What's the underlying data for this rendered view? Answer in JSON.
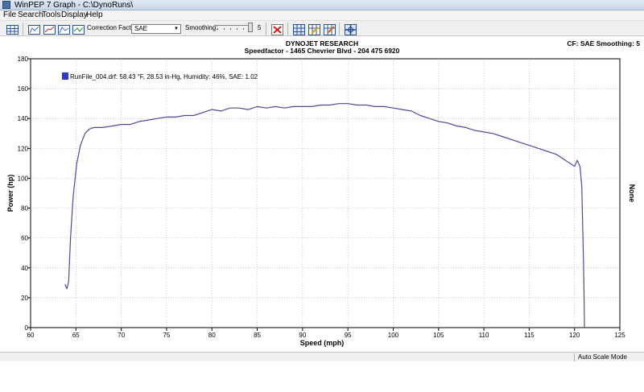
{
  "window": {
    "title": "WinPEP 7    Graph - C:\\DynoRuns\\"
  },
  "menu": {
    "items": [
      "File",
      "Search",
      "Tools",
      "Display",
      "Help"
    ]
  },
  "toolbar": {
    "correction_factor_label": "Correction Factor:",
    "correction_factor_value": "SAE",
    "smoothing_label": "Smoothing:",
    "smoothing_value": "5"
  },
  "header": {
    "company": "DYNOJET RESEARCH",
    "address": "Speedfactor - 1465 Chevrier Blvd - 204 475 6920",
    "cf_info": "CF: SAE  Smoothing: 5"
  },
  "right_axis_label": "None",
  "status": {
    "mode": "Auto Scale Mode"
  },
  "colors": {
    "plot_line": "#4b4b9a",
    "legend_swatch": "#2b3cc8",
    "grid": "#b4b4b4"
  },
  "chart_data": {
    "type": "line",
    "xlabel": "Speed (mph)",
    "ylabel": "Power (hp)",
    "xlim": [
      60,
      125
    ],
    "ylim": [
      0,
      180
    ],
    "x_ticks": [
      60,
      65,
      70,
      75,
      80,
      85,
      90,
      95,
      100,
      105,
      110,
      115,
      120,
      125
    ],
    "y_ticks": [
      0,
      20,
      40,
      60,
      80,
      100,
      120,
      140,
      160,
      180
    ],
    "grid": true,
    "legend_position": "top-left",
    "series": [
      {
        "name": "RunFile_004.drf: 58.43 °F, 28.53 in-Hg, Humidity: 46%, SAE: 1.02",
        "x": [
          63.8,
          64.0,
          64.2,
          64.4,
          64.7,
          65.1,
          65.5,
          66.0,
          66.5,
          67.0,
          68.0,
          69.0,
          70.0,
          71.0,
          72.0,
          73.0,
          74.0,
          75.0,
          76.0,
          77.0,
          78.0,
          79.0,
          80.0,
          81.0,
          82.0,
          83.0,
          84.0,
          85.0,
          86.0,
          87.0,
          88.0,
          89.0,
          90.0,
          91.0,
          92.0,
          93.0,
          94.0,
          95.0,
          96.0,
          97.0,
          98.0,
          99.0,
          100.0,
          101.0,
          102.0,
          103.0,
          104.0,
          105.0,
          106.0,
          107.0,
          108.0,
          109.0,
          110.0,
          111.0,
          112.0,
          113.0,
          114.0,
          115.0,
          116.0,
          117.0,
          118.0,
          119.0,
          119.5,
          120.0,
          120.3,
          120.6,
          120.8,
          121.0,
          121.1
        ],
        "values": [
          29,
          26,
          31,
          60,
          88,
          110,
          122,
          130,
          133,
          134,
          134,
          135,
          136,
          136,
          138,
          139,
          140,
          141,
          141,
          142,
          142,
          144,
          146,
          145,
          147,
          147,
          146,
          148,
          147,
          148,
          147,
          148,
          148,
          148,
          149,
          149,
          150,
          150,
          149,
          149,
          148,
          148,
          147,
          146,
          145,
          142,
          140,
          138,
          137,
          135,
          134,
          132,
          131,
          130,
          128,
          126,
          124,
          122,
          120,
          118,
          116,
          112,
          110,
          108,
          112,
          108,
          95,
          40,
          0
        ]
      }
    ]
  }
}
